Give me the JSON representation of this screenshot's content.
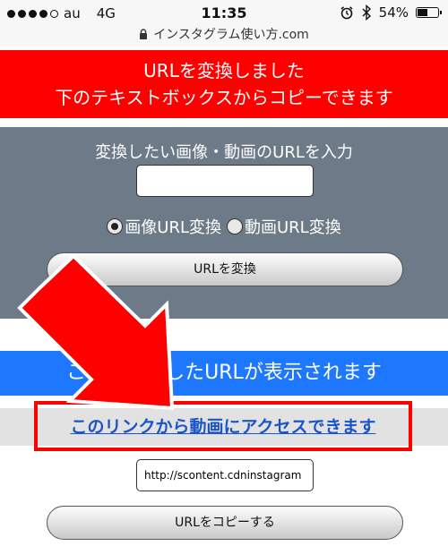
{
  "status_bar": {
    "carrier": "au",
    "network": "4G",
    "time": "11:35",
    "battery": "54%",
    "battery_level": 0.54,
    "url": "インスタグラム使い方.com",
    "icons": [
      "signal-dots",
      "alarm-icon",
      "bluetooth-icon",
      "battery-icon",
      "lock-icon"
    ]
  },
  "banner_success": {
    "line1": "URLを変換しました",
    "line2": "下のテキストボックスからコピーできます",
    "color": "#ff0000"
  },
  "converter": {
    "title": "変換したい画像・動画のURLを入力",
    "input_value": "",
    "radio_image_label": "画像URL変換",
    "radio_video_label": "動画URL変換",
    "selected": "画像URL変換",
    "convert_button": "URLを変換",
    "bg_color": "#6d7a87"
  },
  "result": {
    "banner_text": "ここに変換したURLが表示されます",
    "link_text": "このリンクから動画にアクセスできます",
    "output_value": "http://scontent.cdninstagram",
    "copy_button": "URLをコピーする",
    "accent": "#1e77ff"
  },
  "annotation": {
    "arrow_color": "#ff0000",
    "highlight_color": "#ff0000"
  }
}
